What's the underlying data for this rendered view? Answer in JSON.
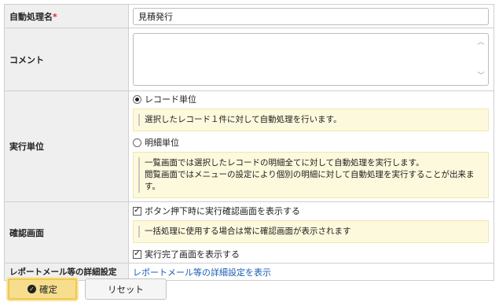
{
  "form": {
    "name": {
      "label": "自動処理名",
      "required_mark": "*",
      "value": "見積発行"
    },
    "comment": {
      "label": "コメント",
      "value": ""
    },
    "unit": {
      "label": "実行単位",
      "option_record": "レコード単位",
      "note_record": "選択したレコード１件に対して自動処理を行います。",
      "option_detail": "明細単位",
      "note_detail_line1": "一覧画面では選択したレコードの明細全てに対して自動処理を実行します。",
      "note_detail_line2": "閲覧画面ではメニューの設定により個別の明細に対して自動処理を実行することが出来ます。",
      "selected": "レコード単位"
    },
    "confirm": {
      "label": "確認画面",
      "check_before": "ボタン押下時に実行確認画面を表示する",
      "check_before_checked": true,
      "note": "一括処理に使用する場合は常に確認画面が表示されます",
      "check_after": "実行完了画面を表示する",
      "check_after_checked": true
    },
    "report": {
      "label": "レポートメール等の詳細設定",
      "link": "レポートメール等の詳細設定を表示"
    }
  },
  "buttons": {
    "confirm_label": "確定",
    "reset_label": "リセット"
  }
}
